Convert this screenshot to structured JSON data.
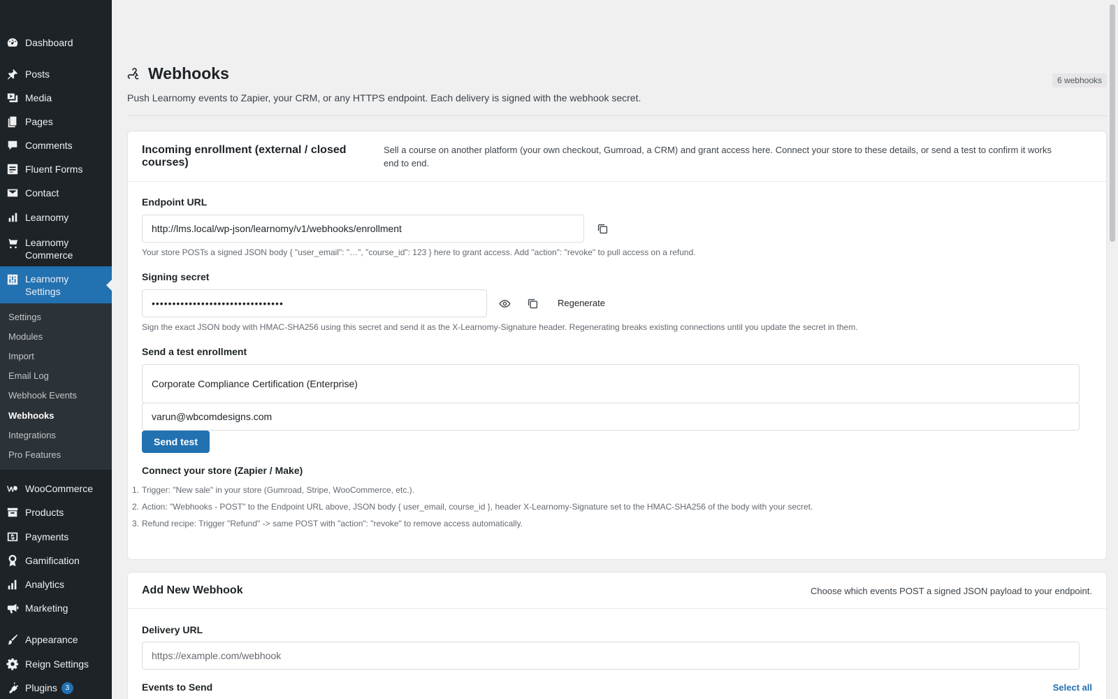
{
  "sidebar": {
    "items": [
      {
        "label": "Dashboard",
        "icon": "dashboard-icon"
      },
      {
        "label": "Posts",
        "icon": "pin-icon"
      },
      {
        "label": "Media",
        "icon": "media-icon"
      },
      {
        "label": "Pages",
        "icon": "pages-icon"
      },
      {
        "label": "Comments",
        "icon": "comment-icon"
      },
      {
        "label": "Fluent Forms",
        "icon": "forms-icon"
      },
      {
        "label": "Contact",
        "icon": "mail-icon"
      },
      {
        "label": "Learnomy",
        "icon": "bar-chart-icon"
      },
      {
        "label": "Learnomy Commerce",
        "icon": "cart-icon"
      },
      {
        "label": "Learnomy Settings",
        "icon": "settings-sliders-icon"
      },
      {
        "label": "WooCommerce",
        "icon": "woo-icon"
      },
      {
        "label": "Products",
        "icon": "archive-icon"
      },
      {
        "label": "Payments",
        "icon": "money-icon"
      },
      {
        "label": "Gamification",
        "icon": "award-icon"
      },
      {
        "label": "Analytics",
        "icon": "analytics-icon"
      },
      {
        "label": "Marketing",
        "icon": "megaphone-icon"
      },
      {
        "label": "Appearance",
        "icon": "brush-icon"
      },
      {
        "label": "Reign Settings",
        "icon": "gear-icon"
      },
      {
        "label": "Plugins",
        "icon": "plugin-icon",
        "badge": "3"
      }
    ],
    "submenu": [
      "Settings",
      "Modules",
      "Import",
      "Email Log",
      "Webhook Events",
      "Webhooks",
      "Integrations",
      "Pro Features"
    ],
    "current_sub": "Webhooks"
  },
  "header": {
    "title": "Webhooks",
    "count": "6 webhooks",
    "description": "Push Learnomy events to Zapier, your CRM, or any HTTPS endpoint. Each delivery is signed with the webhook secret."
  },
  "incoming": {
    "title": "Incoming enrollment (external / closed courses)",
    "note": "Sell a course on another platform (your own checkout, Gumroad, a CRM) and grant access here. Connect your store to these details, or send a test to confirm it works end to end.",
    "endpoint_label": "Endpoint URL",
    "endpoint_value": "http://lms.local/wp-json/learnomy/v1/webhooks/enrollment",
    "endpoint_help": "Your store POSTs a signed JSON body { \"user_email\": \"…\", \"course_id\": 123 } here to grant access. Add \"action\": \"revoke\" to pull access on a refund.",
    "secret_label": "Signing secret",
    "secret_value": "••••••••••••••••••••••••••••••••",
    "regenerate_label": "Regenerate",
    "secret_help": "Sign the exact JSON body with HMAC-SHA256 using this secret and send it as the X-Learnomy-Signature header. Regenerating breaks existing connections until you update the secret in them.",
    "test_label": "Send a test enrollment",
    "test_course": "Corporate Compliance Certification (Enterprise)",
    "test_email": "varun@wbcomdesigns.com",
    "send_test_label": "Send test",
    "connect_title": "Connect your store (Zapier / Make)",
    "steps": [
      "Trigger: \"New sale\" in your store (Gumroad, Stripe, WooCommerce, etc.).",
      "Action: \"Webhooks - POST\" to the Endpoint URL above, JSON body { user_email, course_id }, header X-Learnomy-Signature set to the HMAC-SHA256 of the body with your secret.",
      "Refund recipe: Trigger \"Refund\" -> same POST with \"action\": \"revoke\" to remove access automatically."
    ]
  },
  "add_webhook": {
    "title": "Add New Webhook",
    "note": "Choose which events POST a signed JSON payload to your endpoint.",
    "delivery_label": "Delivery URL",
    "delivery_placeholder": "https://example.com/webhook",
    "events_label": "Events to Send",
    "select_all_label": "Select all"
  }
}
